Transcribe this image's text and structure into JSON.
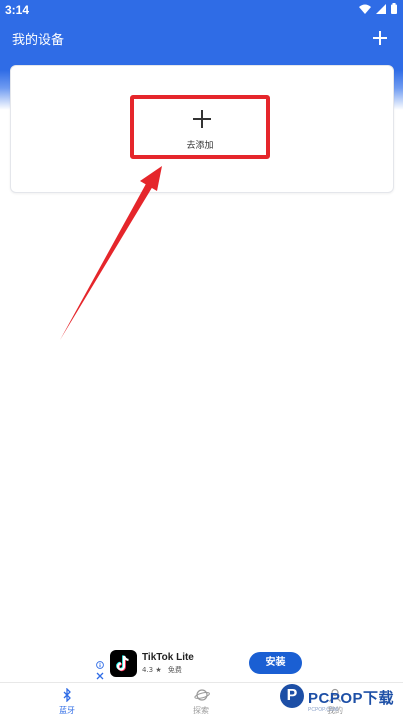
{
  "status_bar": {
    "time": "3:14"
  },
  "header": {
    "title": "我的设备"
  },
  "device_card": {
    "add_label": "去添加"
  },
  "ad": {
    "app_name": "TikTok Lite",
    "rating": "4.3 ★",
    "price": "免费",
    "install_label": "安装"
  },
  "bottom_nav": {
    "items": [
      {
        "label": "蓝牙",
        "icon": "bluetooth-icon",
        "active": true
      },
      {
        "label": "探索",
        "icon": "planet-icon",
        "active": false
      },
      {
        "label": "我的",
        "icon": "person-icon",
        "active": false
      }
    ]
  },
  "watermark": {
    "logo_letter": "P",
    "brand": "PCPOP下载",
    "sub": "PCPOP.COM"
  },
  "colors": {
    "header_blue": "#2f6ce6",
    "highlight_red": "#e5262b",
    "nav_active": "#2f6ce6",
    "nav_inactive": "#9a9a9a",
    "install_blue": "#1a5fd3"
  }
}
